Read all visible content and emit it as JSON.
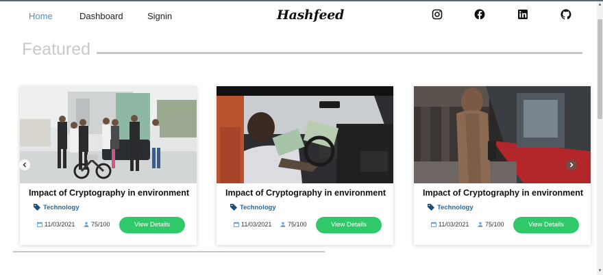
{
  "nav": {
    "links": [
      {
        "label": "Home"
      },
      {
        "label": "Dashboard"
      },
      {
        "label": "Signin"
      }
    ],
    "brand": "Hashfeed",
    "social": [
      "instagram-icon",
      "facebook-icon",
      "linkedin-icon",
      "github-icon"
    ]
  },
  "featured": {
    "title": "Featured"
  },
  "cards": [
    {
      "title": "Impact of Cryptography in environment",
      "category": "Technology",
      "date": "11/03/2021",
      "views": "75/100",
      "button": "View Details",
      "image": "group-with-motorbike-photo"
    },
    {
      "title": "Impact of Cryptography in environment",
      "category": "Technology",
      "date": "11/03/2021",
      "views": "75/100",
      "button": "View Details",
      "image": "man-in-car-with-cash-photo"
    },
    {
      "title": "Impact of Cryptography in environment",
      "category": "Technology",
      "date": "11/03/2021",
      "views": "75/100",
      "button": "View Details",
      "image": "person-at-train-station-photo"
    }
  ],
  "colors": {
    "accent_green": "#2fc96a",
    "active_link": "#4a90c8",
    "tag_blue": "#1e6aa3"
  }
}
